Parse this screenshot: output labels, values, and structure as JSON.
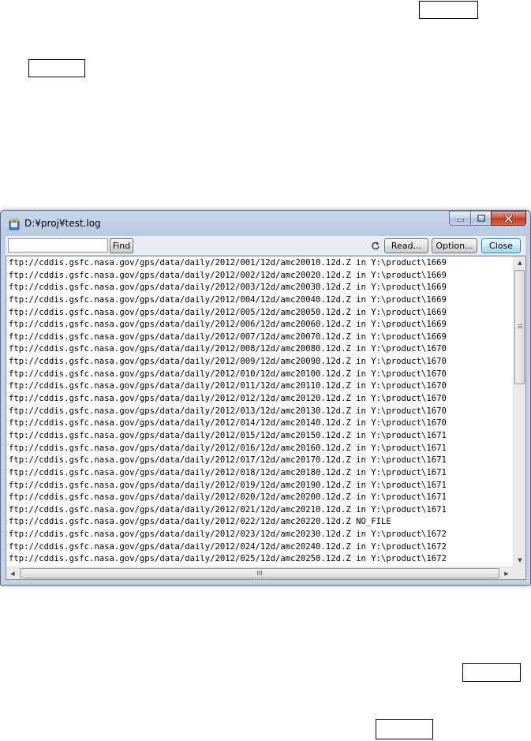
{
  "window": {
    "title": "D:¥proj¥test.log",
    "icon": "log-viewer-app-icon",
    "caption_buttons": [
      "minimize-icon",
      "maximize-icon",
      "close-icon"
    ]
  },
  "toolbar": {
    "search_value": "",
    "find_label": "Find",
    "refresh_icon": "refresh-icon",
    "read_label": "Read...",
    "option_label": "Option...",
    "close_label": "Close"
  },
  "log_lines": [
    "ftp://cddis.gsfc.nasa.gov/gps/data/daily/2012/001/12d/amc20010.12d.Z in Y:\\product\\1669",
    "ftp://cddis.gsfc.nasa.gov/gps/data/daily/2012/002/12d/amc20020.12d.Z in Y:\\product\\1669",
    "ftp://cddis.gsfc.nasa.gov/gps/data/daily/2012/003/12d/amc20030.12d.Z in Y:\\product\\1669",
    "ftp://cddis.gsfc.nasa.gov/gps/data/daily/2012/004/12d/amc20040.12d.Z in Y:\\product\\1669",
    "ftp://cddis.gsfc.nasa.gov/gps/data/daily/2012/005/12d/amc20050.12d.Z in Y:\\product\\1669",
    "ftp://cddis.gsfc.nasa.gov/gps/data/daily/2012/006/12d/amc20060.12d.Z in Y:\\product\\1669",
    "ftp://cddis.gsfc.nasa.gov/gps/data/daily/2012/007/12d/amc20070.12d.Z in Y:\\product\\1669",
    "ftp://cddis.gsfc.nasa.gov/gps/data/daily/2012/008/12d/amc20080.12d.Z in Y:\\product\\1670",
    "ftp://cddis.gsfc.nasa.gov/gps/data/daily/2012/009/12d/amc20090.12d.Z in Y:\\product\\1670",
    "ftp://cddis.gsfc.nasa.gov/gps/data/daily/2012/010/12d/amc20100.12d.Z in Y:\\product\\1670",
    "ftp://cddis.gsfc.nasa.gov/gps/data/daily/2012/011/12d/amc20110.12d.Z in Y:\\product\\1670",
    "ftp://cddis.gsfc.nasa.gov/gps/data/daily/2012/012/12d/amc20120.12d.Z in Y:\\product\\1670",
    "ftp://cddis.gsfc.nasa.gov/gps/data/daily/2012/013/12d/amc20130.12d.Z in Y:\\product\\1670",
    "ftp://cddis.gsfc.nasa.gov/gps/data/daily/2012/014/12d/amc20140.12d.Z in Y:\\product\\1670",
    "ftp://cddis.gsfc.nasa.gov/gps/data/daily/2012/015/12d/amc20150.12d.Z in Y:\\product\\1671",
    "ftp://cddis.gsfc.nasa.gov/gps/data/daily/2012/016/12d/amc20160.12d.Z in Y:\\product\\1671",
    "ftp://cddis.gsfc.nasa.gov/gps/data/daily/2012/017/12d/amc20170.12d.Z in Y:\\product\\1671",
    "ftp://cddis.gsfc.nasa.gov/gps/data/daily/2012/018/12d/amc20180.12d.Z in Y:\\product\\1671",
    "ftp://cddis.gsfc.nasa.gov/gps/data/daily/2012/019/12d/amc20190.12d.Z in Y:\\product\\1671",
    "ftp://cddis.gsfc.nasa.gov/gps/data/daily/2012/020/12d/amc20200.12d.Z in Y:\\product\\1671",
    "ftp://cddis.gsfc.nasa.gov/gps/data/daily/2012/021/12d/amc20210.12d.Z in Y:\\product\\1671",
    "ftp://cddis.gsfc.nasa.gov/gps/data/daily/2012/022/12d/amc20220.12d.Z NO_FILE",
    "ftp://cddis.gsfc.nasa.gov/gps/data/daily/2012/023/12d/amc20230.12d.Z in Y:\\product\\1672",
    "ftp://cddis.gsfc.nasa.gov/gps/data/daily/2012/024/12d/amc20240.12d.Z in Y:\\product\\1672",
    "ftp://cddis.gsfc.nasa.gov/gps/data/daily/2012/025/12d/amc20250.12d.Z in Y:\\product\\1672"
  ],
  "scrollbars": {
    "up_arrow": "▲",
    "down_arrow": "▼",
    "left_arrow": "◀",
    "right_arrow": "▶",
    "h_grip": "III"
  },
  "colors": {
    "frame": "#c4d4e8",
    "close_red": "#c13a20",
    "default_button_blue": "#3c7fb1"
  }
}
